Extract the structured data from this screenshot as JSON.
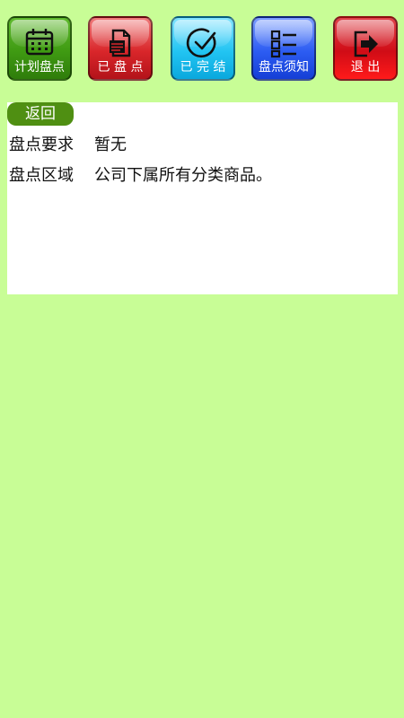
{
  "toolbar": {
    "items": [
      {
        "label": "计划盘点",
        "icon": "calendar-icon",
        "color": "#3f9a12"
      },
      {
        "label": "已 盘 点",
        "icon": "document-icon",
        "color": "#d9262a"
      },
      {
        "label": "已 完 结",
        "icon": "check-circle-icon",
        "color": "#22c4f2"
      },
      {
        "label": "盘点须知",
        "icon": "list-icon",
        "color": "#2c5cf2"
      },
      {
        "label": "退   出",
        "icon": "exit-icon",
        "color": "#d00c16"
      }
    ]
  },
  "detail": {
    "back_label": "返回",
    "rows": [
      {
        "key": "盘点要求",
        "value": "暂无"
      },
      {
        "key": "盘点区域",
        "value": "公司下属所有分类商品。"
      }
    ]
  },
  "colors": {
    "background": "#c8fd96",
    "back_button": "#4f8f12",
    "panel": "#ffffff"
  }
}
